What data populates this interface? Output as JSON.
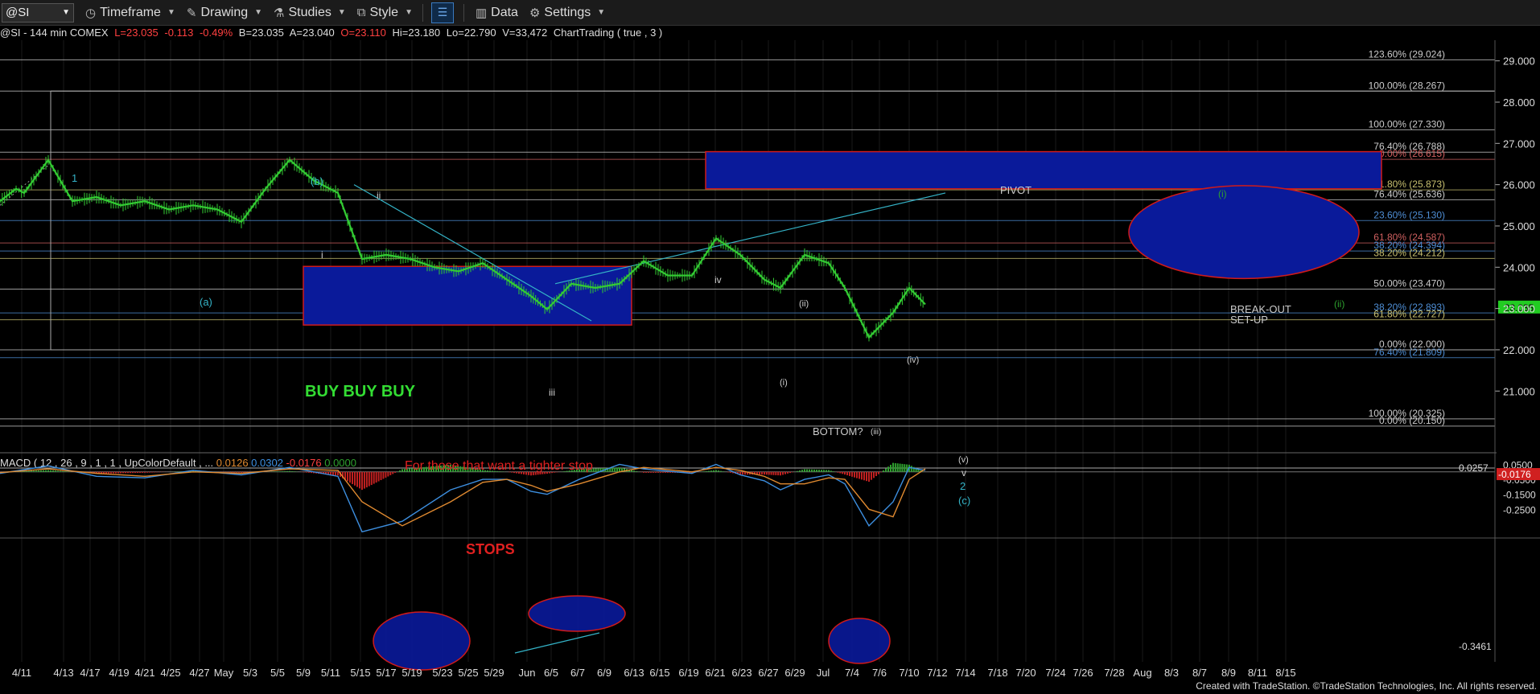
{
  "toolbar": {
    "symbol": "@SI",
    "timeframe_label": "Timeframe",
    "drawing_label": "Drawing",
    "studies_label": "Studies",
    "style_label": "Style",
    "data_label": "Data",
    "settings_label": "Settings"
  },
  "infobar": {
    "desc": "@SI - 144 min  COMEX",
    "last": "L=23.035",
    "change": "-0.113",
    "pct": "-0.49%",
    "bid": "B=23.035",
    "ask": "A=23.040",
    "open": "O=23.110",
    "high": "Hi=23.180",
    "low": "Lo=22.790",
    "volume": "V=33,472",
    "study": "ChartTrading ( true , 3 )"
  },
  "macd_header": {
    "label": "MACD ( 12 , 26 , 9 , 1 , 1 , UpColorDefault , ...",
    "v1": "0.0126",
    "v2": "0.0302",
    "v3": "-0.0176",
    "v4": "0.0000"
  },
  "footer": "Created with TradeStation. ©TradeStation Technologies, Inc. All rights reserved.",
  "colors": {
    "price": "#33cc33",
    "macd_line": "#3d8fe0",
    "signal_line": "#e08a30",
    "hist_pos": "#2ea02e",
    "hist_neg": "#c02020",
    "box_fill": "#0a1a9a",
    "box_border": "#d01a1a",
    "wave_label": "#34b3c7",
    "fib_red": "#d06060",
    "fib_yellow": "#c8c070",
    "fib_blue": "#4f8fd6",
    "fib_white": "#cccccc"
  },
  "chart_data": {
    "type": "line",
    "instrument": "@SI - 144 min COMEX",
    "y_axis_side": "right",
    "ylim": [
      19.7,
      29.5
    ],
    "price_ticks": [
      "29.000",
      "28.000",
      "27.000",
      "26.000",
      "25.000",
      "24.000",
      "23.000",
      "22.000",
      "21.000"
    ],
    "last_price_tag": "23.035",
    "x_ticks": [
      "4/11",
      "4/13",
      "4/17",
      "4/19",
      "4/21",
      "4/25",
      "4/27",
      "May",
      "5/3",
      "5/5",
      "5/9",
      "5/11",
      "5/15",
      "5/17",
      "5/19",
      "5/23",
      "5/25",
      "5/29",
      "Jun",
      "6/5",
      "6/7",
      "6/9",
      "6/13",
      "6/15",
      "6/19",
      "6/21",
      "6/23",
      "6/27",
      "6/29",
      "Jul",
      "7/4",
      "7/6",
      "7/10",
      "7/12",
      "7/14",
      "7/18",
      "7/20",
      "7/24",
      "7/26",
      "7/28",
      "Aug",
      "8/3",
      "8/7",
      "8/9",
      "8/11",
      "8/15"
    ],
    "price_path": [
      [
        0,
        25.6
      ],
      [
        2,
        25.9
      ],
      [
        3,
        25.8
      ],
      [
        6,
        26.6
      ],
      [
        9,
        25.6
      ],
      [
        12,
        25.7
      ],
      [
        15,
        25.5
      ],
      [
        18,
        25.6
      ],
      [
        21,
        25.4
      ],
      [
        24,
        25.5
      ],
      [
        27,
        25.4
      ],
      [
        30,
        25.1
      ],
      [
        33,
        25.9
      ],
      [
        36,
        26.6
      ],
      [
        39,
        26.1
      ],
      [
        42,
        25.8
      ],
      [
        45,
        24.2
      ],
      [
        48,
        24.3
      ],
      [
        51,
        24.2
      ],
      [
        54,
        24.0
      ],
      [
        57,
        23.9
      ],
      [
        60,
        24.1
      ],
      [
        63,
        23.7
      ],
      [
        66,
        23.3
      ],
      [
        68,
        22.98
      ],
      [
        71,
        23.6
      ],
      [
        74,
        23.5
      ],
      [
        77,
        23.6
      ],
      [
        80,
        24.15
      ],
      [
        83,
        23.8
      ],
      [
        86,
        23.8
      ],
      [
        89,
        24.7
      ],
      [
        92,
        24.3
      ],
      [
        95,
        23.7
      ],
      [
        97,
        23.5
      ],
      [
        100,
        24.3
      ],
      [
        103,
        24.1
      ],
      [
        105,
        23.5
      ],
      [
        108,
        22.3
      ],
      [
        111,
        22.9
      ],
      [
        113,
        23.5
      ],
      [
        115,
        23.1
      ]
    ],
    "macd": {
      "ylim": [
        -0.42,
        0.09
      ],
      "value_ticks": [
        "0.0500",
        "-0.0500",
        "-0.1500",
        "-0.2500"
      ],
      "tags": [
        "0.0257",
        "-0.0176",
        "-0.3461"
      ],
      "macd_line": [
        [
          0,
          -0.01
        ],
        [
          6,
          0.04
        ],
        [
          12,
          -0.03
        ],
        [
          18,
          -0.04
        ],
        [
          24,
          0.01
        ],
        [
          30,
          -0.02
        ],
        [
          36,
          0.03
        ],
        [
          42,
          -0.03
        ],
        [
          45,
          -0.4
        ],
        [
          50,
          -0.33
        ],
        [
          56,
          -0.12
        ],
        [
          60,
          -0.05
        ],
        [
          63,
          -0.05
        ],
        [
          66,
          -0.13
        ],
        [
          68,
          -0.15
        ],
        [
          72,
          -0.05
        ],
        [
          77,
          0.05
        ],
        [
          80,
          0.02
        ],
        [
          86,
          -0.01
        ],
        [
          89,
          0.05
        ],
        [
          92,
          -0.02
        ],
        [
          95,
          -0.06
        ],
        [
          97,
          -0.12
        ],
        [
          100,
          -0.05
        ],
        [
          103,
          -0.02
        ],
        [
          105,
          -0.08
        ],
        [
          108,
          -0.36
        ],
        [
          111,
          -0.2
        ],
        [
          113,
          0.03
        ],
        [
          115,
          0.01
        ]
      ],
      "signal_line": [
        [
          0,
          -0.005
        ],
        [
          6,
          0.02
        ],
        [
          12,
          -0.01
        ],
        [
          18,
          -0.03
        ],
        [
          24,
          0.0
        ],
        [
          30,
          -0.01
        ],
        [
          36,
          0.02
        ],
        [
          42,
          0.01
        ],
        [
          45,
          -0.2
        ],
        [
          50,
          -0.36
        ],
        [
          56,
          -0.2
        ],
        [
          60,
          -0.07
        ],
        [
          63,
          -0.05
        ],
        [
          66,
          -0.09
        ],
        [
          68,
          -0.13
        ],
        [
          72,
          -0.08
        ],
        [
          77,
          0.0
        ],
        [
          80,
          0.03
        ],
        [
          86,
          0.0
        ],
        [
          89,
          0.03
        ],
        [
          92,
          0.01
        ],
        [
          95,
          -0.03
        ],
        [
          97,
          -0.08
        ],
        [
          100,
          -0.08
        ],
        [
          103,
          -0.04
        ],
        [
          105,
          -0.05
        ],
        [
          108,
          -0.25
        ],
        [
          111,
          -0.3
        ],
        [
          113,
          -0.05
        ],
        [
          115,
          0.02
        ]
      ]
    },
    "fib_levels": [
      {
        "price": 29.024,
        "label": "123.60% (29.024)",
        "color": "#cccccc"
      },
      {
        "price": 28.267,
        "label": "100.00% (28.267)",
        "color": "#cccccc"
      },
      {
        "price": 27.33,
        "label": "100.00% (27.330)",
        "color": "#cccccc"
      },
      {
        "price": 26.788,
        "label": "76.40% (26.788)",
        "color": "#cccccc"
      },
      {
        "price": 26.615,
        "label": "0.00% (26.615)",
        "color": "#d06060"
      },
      {
        "price": 25.873,
        "label": "61.80% (25.873)",
        "color": "#c8c070"
      },
      {
        "price": 25.636,
        "label": "76.40% (25.636)",
        "color": "#cccccc"
      },
      {
        "price": 25.13,
        "label": "23.60% (25.130)",
        "color": "#4f8fd6"
      },
      {
        "price": 24.587,
        "label": "61.80% (24.587)",
        "color": "#d06060"
      },
      {
        "price": 24.394,
        "label": "38.20% (24.394)",
        "color": "#4f8fd6"
      },
      {
        "price": 24.212,
        "label": "38.20% (24.212)",
        "color": "#c8c070"
      },
      {
        "price": 23.47,
        "label": "50.00% (23.470)",
        "color": "#cccccc"
      },
      {
        "price": 22.893,
        "label": "38.20% (22.893)",
        "color": "#4f8fd6"
      },
      {
        "price": 22.727,
        "label": "61.80% (22.727)",
        "color": "#c8c070"
      },
      {
        "price": 22.0,
        "label": "0.00% (22.000)",
        "color": "#cccccc"
      },
      {
        "price": 21.809,
        "label": "76.40% (21.809)",
        "color": "#4f8fd6"
      },
      {
        "price": 20.325,
        "label": "100.00% (20.325)",
        "color": "#cccccc"
      },
      {
        "price": 20.15,
        "label": "0.00% (20.150)",
        "color": "#cccccc"
      }
    ],
    "annotations": {
      "pivot": "PIVOT",
      "buy": "BUY BUY BUY",
      "bottom": "BOTTOM?",
      "breakout": [
        "BREAK-OUT",
        "SET-UP"
      ],
      "tighter_stop": "For those that want a tighter stop",
      "stops": "STOPS",
      "waves": [
        {
          "text": "1",
          "color": "#34b3c7"
        },
        {
          "text": "(b)",
          "color": "#34b3c7"
        },
        {
          "text": "ii",
          "color": "#cccccc"
        },
        {
          "text": "i",
          "color": "#cccccc"
        },
        {
          "text": "(a)",
          "color": "#34b3c7"
        },
        {
          "text": "iii",
          "color": "#cccccc"
        },
        {
          "text": "iv",
          "color": "#cccccc"
        },
        {
          "text": "(ii)",
          "color": "#cccccc"
        },
        {
          "text": "(i)",
          "color": "#cccccc"
        },
        {
          "text": "(iv)",
          "color": "#cccccc"
        },
        {
          "text": "(iii)",
          "color": "#cccccc"
        },
        {
          "text": "(v)",
          "color": "#cccccc"
        },
        {
          "text": "v",
          "color": "#cccccc"
        },
        {
          "text": "2",
          "color": "#34b3c7"
        },
        {
          "text": "(c)",
          "color": "#34b3c7"
        },
        {
          "text": "(i)",
          "color": "#2ea02e"
        },
        {
          "text": "(ii)",
          "color": "#2ea02e"
        }
      ]
    }
  }
}
